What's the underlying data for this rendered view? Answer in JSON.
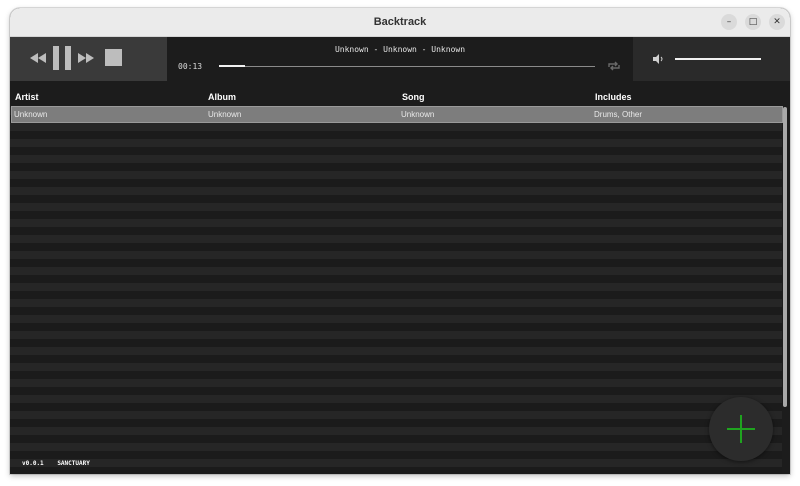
{
  "window": {
    "title": "Backtrack",
    "minimize_glyph": "–",
    "maximize_glyph": "□",
    "close_glyph": "✕"
  },
  "player": {
    "controls": [
      "rewind-icon",
      "pause-icon",
      "fast-forward-icon",
      "stop-icon"
    ],
    "now_playing": "Unknown - Unknown - Unknown",
    "elapsed": "00:13",
    "progress_fraction": 0.07,
    "repeat_icon": "repeat-icon",
    "volume_icon": "speaker-icon",
    "volume_fraction": 1.0
  },
  "table": {
    "columns": [
      "Artist",
      "Album",
      "Song",
      "Includes"
    ],
    "rows": [
      [
        "Unknown",
        "Unknown",
        "Unknown",
        "Drums, Other"
      ]
    ],
    "selected_row": 0
  },
  "footer": {
    "version": "v0.0.1",
    "brand": "SANCTUARY"
  },
  "fab": {
    "icon": "plus-icon",
    "color": "#1fa31f"
  },
  "colors": {
    "background": "#1c1c1c",
    "selected_row": "#7d7d7d",
    "accent_green": "#1fa31f"
  }
}
